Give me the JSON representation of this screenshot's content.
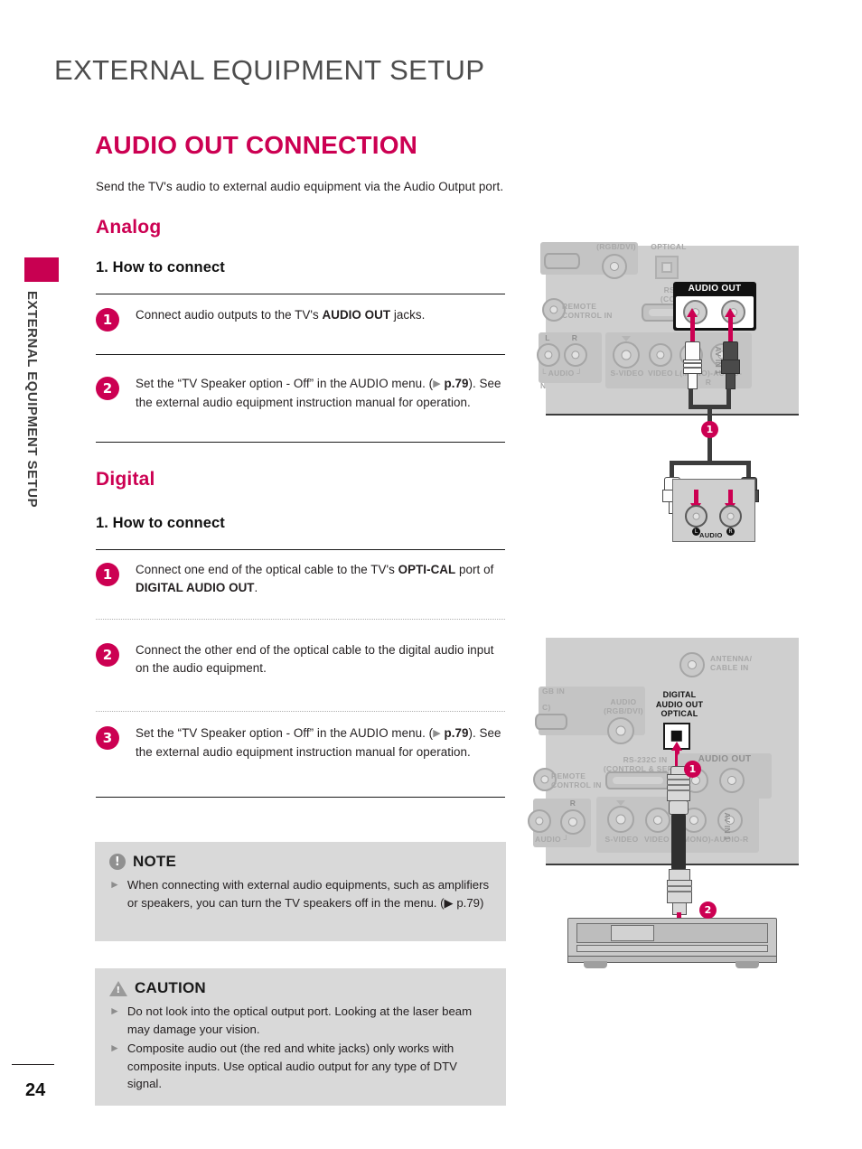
{
  "sidebar": {
    "vertical_label": "EXTERNAL EQUIPMENT SETUP",
    "page_number": "24"
  },
  "header": {
    "chapter_title": "EXTERNAL EQUIPMENT SETUP",
    "section_title": "AUDIO OUT CONNECTION",
    "section_intro": "Send the TV's audio to external audio equipment via the Audio Output port."
  },
  "analog": {
    "heading": "Analog",
    "howto": "1. How to connect",
    "steps": [
      {
        "number": "1",
        "parts": [
          {
            "t": "Connect audio outputs to the TV's ",
            "b": false
          },
          {
            "t": "AUDIO OUT",
            "b": true
          },
          {
            "t": " jacks.",
            "b": false
          }
        ]
      },
      {
        "number": "2",
        "parts": [
          {
            "t": "Set the “TV Speaker option - Off” in the AUDIO menu. (",
            "b": false
          },
          {
            "t": "▶",
            "b": false,
            "tri": true
          },
          {
            "t": " p.79",
            "b": true
          },
          {
            "t": "). See the external audio equipment instruction manual for operation.",
            "b": false
          }
        ]
      }
    ]
  },
  "digital": {
    "heading": "Digital",
    "howto": "1. How to connect",
    "steps": [
      {
        "number": "1",
        "parts": [
          {
            "t": "Connect one end of the optical cable to the TV's ",
            "b": false
          },
          {
            "t": "OPTI-CAL",
            "b": true
          },
          {
            "t": " port of ",
            "b": false
          },
          {
            "t": "DIGITAL AUDIO OUT",
            "b": true
          },
          {
            "t": ".",
            "b": false
          }
        ]
      },
      {
        "number": "2",
        "parts": [
          {
            "t": "Connect the other end of the optical cable to the digital audio input on the audio equipment.",
            "b": false
          }
        ]
      },
      {
        "number": "3",
        "parts": [
          {
            "t": "Set the “TV Speaker option - Off” in the AUDIO menu. (",
            "b": false
          },
          {
            "t": "▶",
            "b": false,
            "tri": true
          },
          {
            "t": " p.79",
            "b": true
          },
          {
            "t": "). See the external audio equipment instruction manual for operation.",
            "b": false
          }
        ]
      }
    ]
  },
  "note": {
    "title": "NOTE",
    "icon": "exclamation-circle-icon",
    "bullets": [
      "When connecting with external audio equipments, such as amplifiers or speakers, you can turn the TV speakers off in the menu.  (▶ p.79)"
    ]
  },
  "caution": {
    "title": "CAUTION",
    "icon": "warning-triangle-icon",
    "bullets": [
      "Do not look into the optical output port. Looking at the laser beam may damage your vision.",
      "Composite audio out (the red and white jacks) only works with composite inputs. Use optical audio output for any type of DTV signal."
    ]
  },
  "diagram_analog": {
    "labels": {
      "rgb_dvi": "(RGB/DVI)",
      "optical": "OPTICAL",
      "rs232c": "RS-232C IN\n(CONTROL & SERVICE)",
      "remote": "REMOTE\nCONTROL IN",
      "l": "L",
      "r": "R",
      "audio_in": "└ AUDIO ┘",
      "in": "N",
      "svideo": "S-VIDEO",
      "video": "VIDEO",
      "audio_lr": "L(MONO)-AUDIO-R",
      "av_in_1": "AV IN 1",
      "audio_out": "AUDIO OUT"
    },
    "callout": "1",
    "equipment": {
      "audio": "AUDIO",
      "left": "L",
      "right": "R"
    }
  },
  "diagram_digital": {
    "labels": {
      "antenna": "ANTENNA/\nCABLE IN",
      "rgb_in": "GB IN",
      "pc": "C)",
      "audio_rgb": "AUDIO\n(RGB/DVI)",
      "digital_audio_out": "DIGITAL\nAUDIO OUT\nOPTICAL",
      "rs232c": "RS-232C IN\n(CONTROL & SERVIC",
      "remote": "REMOTE\nCONTROL IN",
      "r": "R",
      "audio_in": "AUDIO ┘",
      "svideo": "S-VIDEO",
      "video": "VIDEO",
      "audio_lr": "L(MONO)-AUDIO-R",
      "av_in_1": "AV IN 1",
      "audio_out": "AUDIO OUT"
    },
    "callout_1": "1",
    "callout_2": "2"
  },
  "colors": {
    "accent": "#cc0052",
    "chapter": "#4d4d4d",
    "panel_gray": "#cfcfcf",
    "box_gray": "#d9d9d9"
  }
}
